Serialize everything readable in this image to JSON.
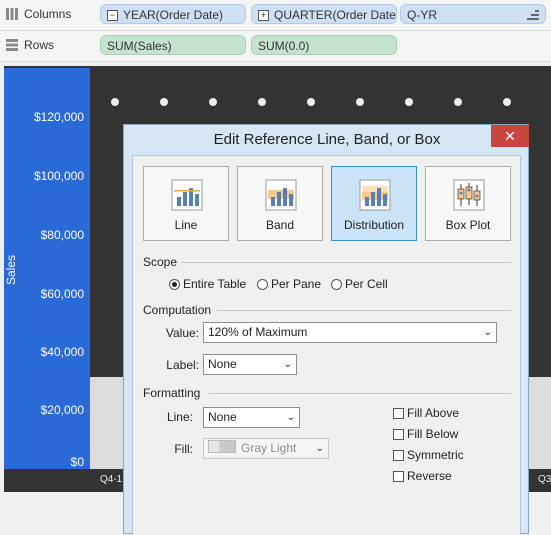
{
  "shelves": {
    "columns": {
      "label": "Columns",
      "pills": [
        "YEAR(Order Date)",
        "QUARTER(Order Date)",
        "Q-YR"
      ]
    },
    "rows": {
      "label": "Rows",
      "pills": [
        "SUM(Sales)",
        "SUM(0.0)"
      ]
    }
  },
  "chart": {
    "y_title": "Sales",
    "y_ticks": [
      "$120,000",
      "$100,000",
      "$80,000",
      "$60,000",
      "$40,000",
      "$20,000",
      "$0"
    ],
    "x_ticks": [
      "Q4-1",
      "Q3"
    ]
  },
  "dialog": {
    "title": "Edit Reference Line, Band, or Box",
    "close": "✕",
    "types": [
      "Line",
      "Band",
      "Distribution",
      "Box Plot"
    ],
    "selected_type": "Distribution",
    "scope": {
      "heading": "Scope",
      "options": [
        "Entire Table",
        "Per Pane",
        "Per Cell"
      ],
      "selected": "Entire Table"
    },
    "computation": {
      "heading": "Computation",
      "value_label": "Value:",
      "value": "120% of Maximum",
      "label_label": "Label:",
      "label_value": "None"
    },
    "formatting": {
      "heading": "Formatting",
      "line_label": "Line:",
      "line_value": "None",
      "fill_label": "Fill:",
      "fill_value": "Gray Light",
      "checkboxes": [
        "Fill Above",
        "Fill Below",
        "Symmetric",
        "Reverse"
      ]
    }
  }
}
